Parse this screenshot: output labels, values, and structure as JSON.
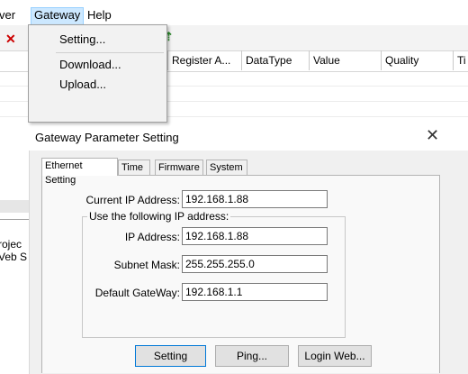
{
  "menu": {
    "partial_left": "ver",
    "gateway": "Gateway",
    "help": "Help"
  },
  "dropdown": {
    "items": [
      "Setting...",
      "Download...",
      "Upload..."
    ]
  },
  "grid": {
    "columns": [
      "Register A...",
      "DataType",
      "Value",
      "Quality",
      "Ti"
    ]
  },
  "side": {
    "item1": "rojec",
    "item2": "Veb S"
  },
  "dialog": {
    "title": "Gateway Parameter Setting",
    "close_glyph": "✕",
    "tabs": [
      "Ethernet Setting",
      "Time",
      "Firmware",
      "System"
    ],
    "current_ip_label": "Current IP Address:",
    "current_ip_value": "192.168.1.88",
    "group_label": "Use the following IP address:",
    "ip_label": "IP Address:",
    "ip_value": "192.168.1.88",
    "mask_label": "Subnet Mask:",
    "mask_value": "255.255.255.0",
    "gateway_label": "Default GateWay:",
    "gateway_value": "192.168.1.1",
    "buttons": {
      "setting": "Setting",
      "ping": "Ping...",
      "login": "Login Web..."
    }
  },
  "colors": {
    "menu_highlight": "#cce8ff",
    "accent": "#0078d7"
  }
}
